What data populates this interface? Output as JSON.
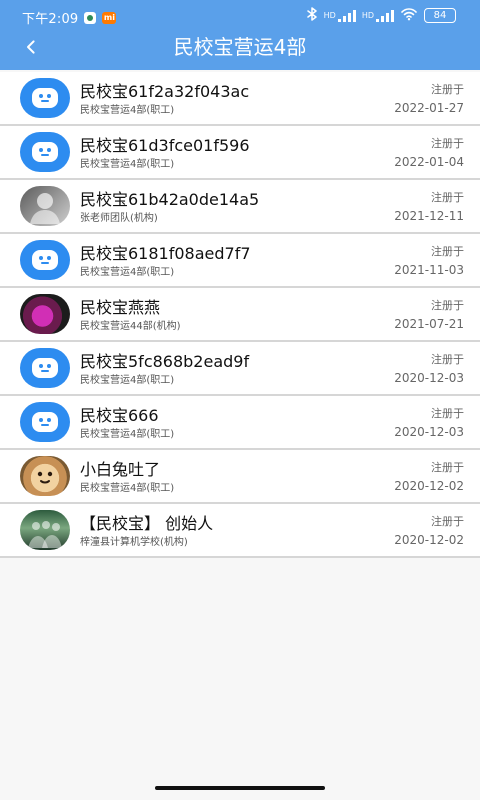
{
  "statusbar": {
    "time": "下午2:09",
    "badge_mi": "mi",
    "battery": "84",
    "signal_labels": [
      "HD",
      "HD"
    ]
  },
  "header": {
    "title": "民校宝营运4部",
    "back_icon": "chevron-left-icon"
  },
  "list": {
    "items": [
      {
        "name": "民校宝61f2a32f043ac",
        "sub": "民校宝营运4部(职工)",
        "reg_label": "注册于",
        "date": "2022-01-27",
        "avatar": "robot"
      },
      {
        "name": "民校宝61d3fce01f596",
        "sub": "民校宝营运4部(职工)",
        "reg_label": "注册于",
        "date": "2022-01-04",
        "avatar": "robot"
      },
      {
        "name": "民校宝61b42a0de14a5",
        "sub": "张老师团队(机构)",
        "reg_label": "注册于",
        "date": "2021-12-11",
        "avatar": "person"
      },
      {
        "name": "民校宝6181f08aed7f7",
        "sub": "民校宝营运4部(职工)",
        "reg_label": "注册于",
        "date": "2021-11-03",
        "avatar": "robot"
      },
      {
        "name": "民校宝燕燕",
        "sub": "民校宝营运44部(机构)",
        "reg_label": "注册于",
        "date": "2021-07-21",
        "avatar": "flower"
      },
      {
        "name": "民校宝5fc868b2ead9f",
        "sub": "民校宝营运4部(职工)",
        "reg_label": "注册于",
        "date": "2020-12-03",
        "avatar": "robot"
      },
      {
        "name": "民校宝666",
        "sub": "民校宝营运4部(职工)",
        "reg_label": "注册于",
        "date": "2020-12-03",
        "avatar": "robot"
      },
      {
        "name": "小白兔吐了",
        "sub": "民校宝营运4部(职工)",
        "reg_label": "注册于",
        "date": "2020-12-02",
        "avatar": "dog"
      },
      {
        "name": "【民校宝】 创始人",
        "sub": "梓潼县计算机学校(机构)",
        "reg_label": "注册于",
        "date": "2020-12-02",
        "avatar": "group"
      }
    ]
  }
}
